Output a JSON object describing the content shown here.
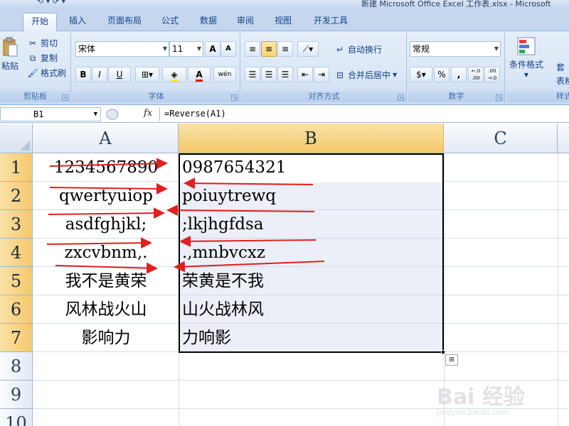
{
  "window": {
    "title": "新建 Microsoft Office Excel 工作表.xlsx - Microsoft"
  },
  "tabs": [
    {
      "label": "开始",
      "active": true
    },
    {
      "label": "插入"
    },
    {
      "label": "页面布局"
    },
    {
      "label": "公式"
    },
    {
      "label": "数据"
    },
    {
      "label": "审阅"
    },
    {
      "label": "视图"
    },
    {
      "label": "开发工具"
    }
  ],
  "ribbon": {
    "clipboard": {
      "label": "剪贴板",
      "paste": "粘贴",
      "cut": "剪切",
      "copy": "复制",
      "format_painter": "格式刷"
    },
    "font": {
      "label": "字体",
      "font_name": "宋体",
      "font_size": "11",
      "bold": "B",
      "italic": "I",
      "underline": "U",
      "grow": "A",
      "shrink": "A",
      "font_color": "A",
      "phonetic": "wén"
    },
    "alignment": {
      "label": "对齐方式",
      "wrap_text": "自动换行",
      "merge_center": "合并后居中"
    },
    "number": {
      "label": "数字",
      "format": "常规",
      "percent": "%",
      "comma": ",",
      "inc_decimal": "←.0 .00",
      "dec_decimal": ".00 →.0"
    },
    "styles": {
      "conditional_format": "条件格式",
      "table_format_1": "套",
      "table_format_2": "表格格",
      "label": "样式"
    }
  },
  "formula_bar": {
    "name_box": "B1",
    "fx": "fx",
    "formula": "=Reverse(A1)"
  },
  "sheet": {
    "columns": [
      "A",
      "B",
      "C"
    ],
    "rows": [
      "1",
      "2",
      "3",
      "4",
      "5",
      "6",
      "7",
      "8",
      "9",
      "10"
    ],
    "col_a": [
      "1234567890",
      "qwertyuiop",
      "asdfghjkl;",
      "zxcvbnm,.",
      "我不是黄荣",
      "风林战火山",
      "影响力"
    ],
    "col_b": [
      "0987654321",
      "poiuytrewq",
      ";lkjhgfdsa",
      ".,mnbvcxz",
      "荣黄是不我",
      "山火战林风",
      "力响影"
    ]
  },
  "annotation_color": "#e02020",
  "selection_color": "#f4c96b",
  "watermark": {
    "text": "Bai 经验",
    "sub": "jingyan.baidu.com"
  }
}
